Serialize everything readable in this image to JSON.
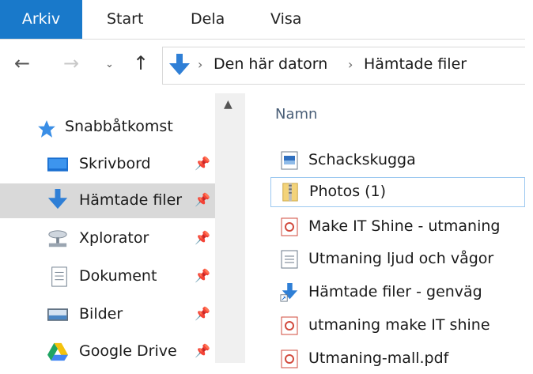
{
  "ribbon": {
    "tabs": [
      {
        "label": "Arkiv"
      },
      {
        "label": "Start"
      },
      {
        "label": "Dela"
      },
      {
        "label": "Visa"
      }
    ]
  },
  "address": {
    "crumbs": [
      "Den här datorn",
      "Hämtade filer"
    ]
  },
  "nav": {
    "quick_access": "Snabbåtkomst",
    "items": [
      {
        "label": "Skrivbord",
        "icon": "desktop-icon"
      },
      {
        "label": "Hämtade filer",
        "icon": "download-arrow-icon"
      },
      {
        "label": "Xplorator",
        "icon": "network-drive-icon"
      },
      {
        "label": "Dokument",
        "icon": "document-icon"
      },
      {
        "label": "Bilder",
        "icon": "pictures-icon"
      },
      {
        "label": "Google Drive",
        "icon": "google-drive-icon"
      }
    ]
  },
  "content": {
    "column_name": "Namn",
    "files": [
      {
        "name": "Schackskugga",
        "icon": "image-file-icon"
      },
      {
        "name": "Photos (1)",
        "icon": "zip-folder-icon"
      },
      {
        "name": "Make IT Shine - utmaning",
        "icon": "pdf-icon"
      },
      {
        "name": "Utmaning ljud och vågor",
        "icon": "text-file-icon"
      },
      {
        "name": "Hämtade filer - genväg",
        "icon": "shortcut-icon"
      },
      {
        "name": "utmaning make IT shine",
        "icon": "pdf-icon"
      },
      {
        "name": "Utmaning-mall.pdf",
        "icon": "pdf-icon"
      }
    ]
  },
  "colors": {
    "accent": "#1979ca",
    "selected_nav": "#d9d9d9",
    "header_text": "#4a5f78"
  }
}
